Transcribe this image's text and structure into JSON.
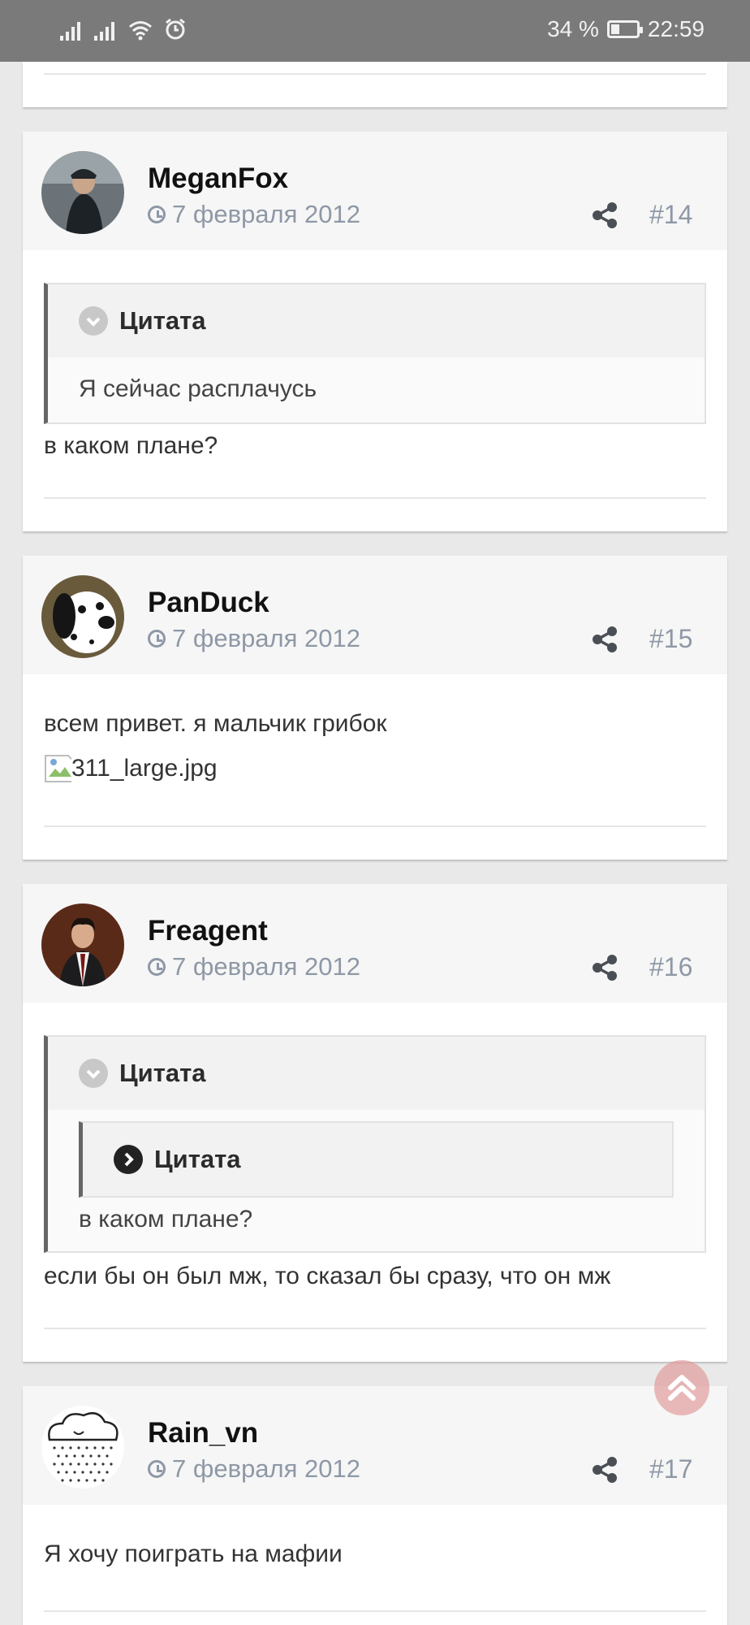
{
  "status_bar": {
    "battery_text": "34 %",
    "time": "22:59",
    "battery_level": 0.34
  },
  "posts": [
    {
      "username": "MeganFox",
      "date": "7 февраля 2012",
      "number": "#14",
      "quote_title": "Цитата",
      "quote_text": "Я сейчас расплачусь",
      "text": "в каком плане?"
    },
    {
      "username": "PanDuck",
      "date": "7 февраля 2012",
      "number": "#15",
      "text": "всем привет. я мальчик грибок",
      "image_alt": "311_large.jpg"
    },
    {
      "username": "Freagent",
      "date": "7 февраля 2012",
      "number": "#16",
      "quote_title": "Цитата",
      "nested_quote_title": "Цитата",
      "quote_text": "в каком плане?",
      "text": "если бы он был мж, то сказал бы сразу, что он мж"
    },
    {
      "username": "Rain_vn",
      "date": "7 февраля 2012",
      "number": "#17",
      "text": "Я хочу поиграть на мафии"
    }
  ],
  "colors": {
    "accent_meta": "#8e98a6",
    "scroll_top": "#e39a9a"
  }
}
